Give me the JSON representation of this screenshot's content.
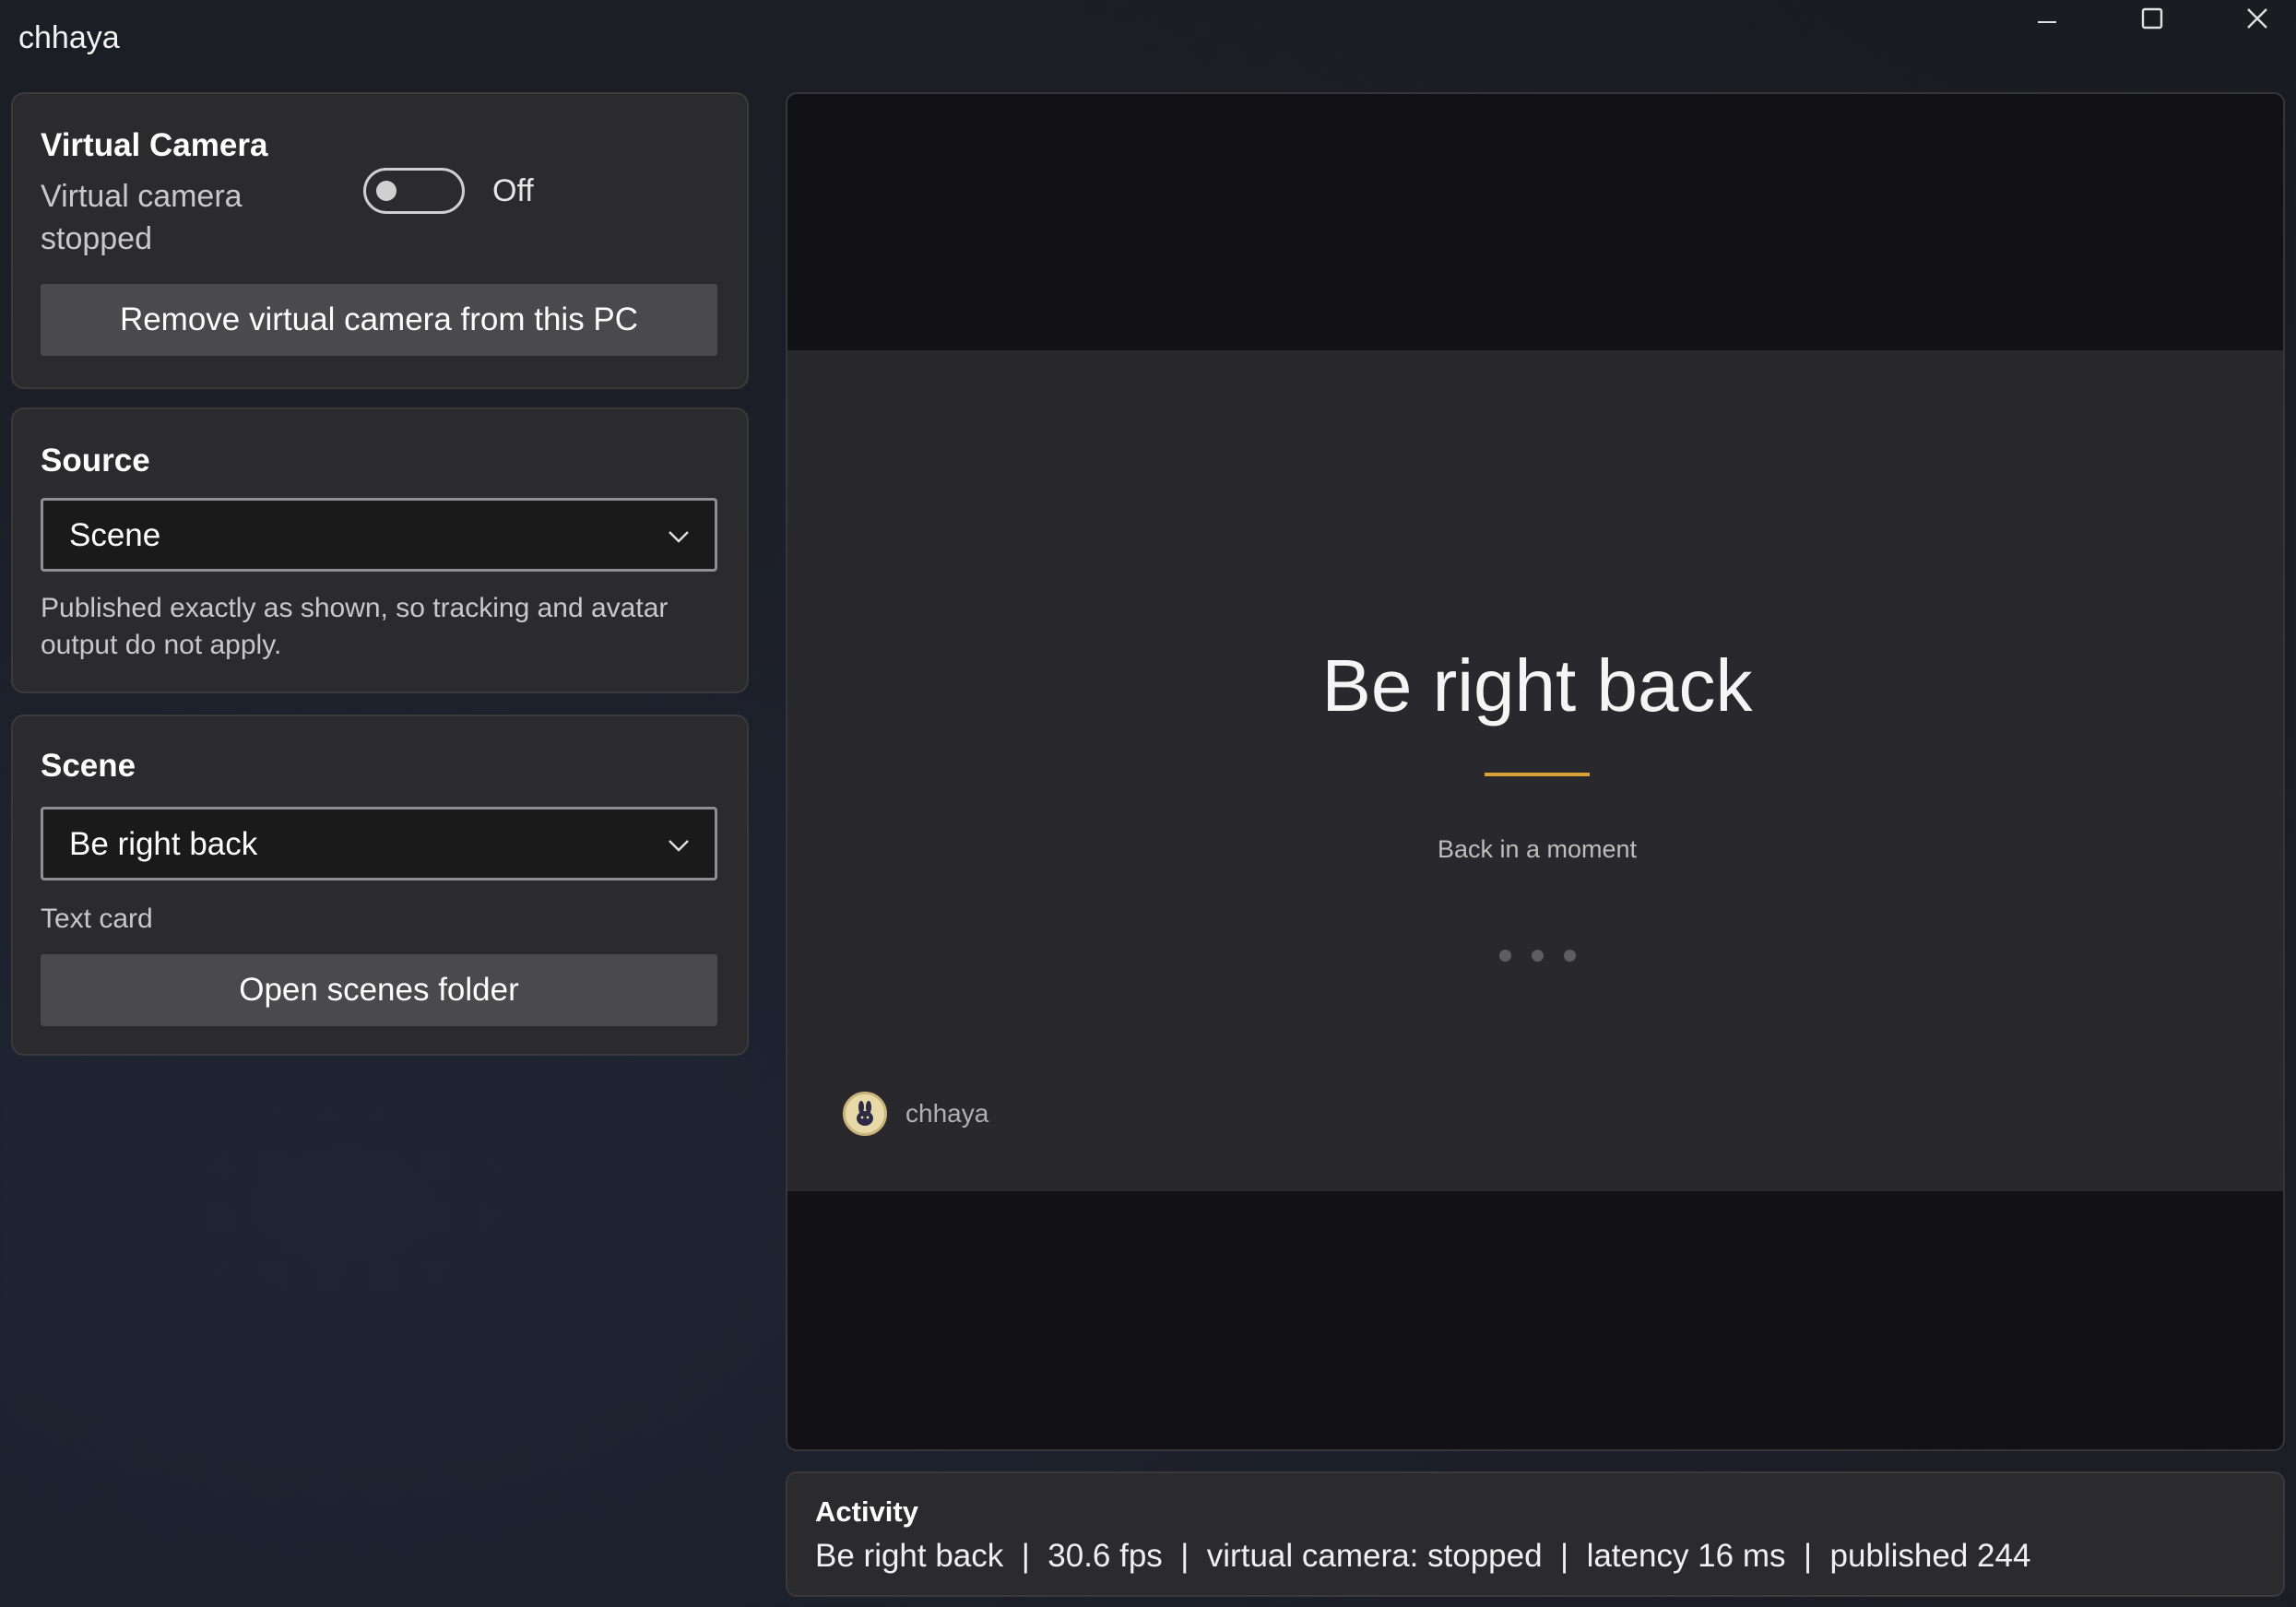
{
  "window": {
    "title": "chhaya"
  },
  "virtual_camera": {
    "title": "Virtual Camera",
    "status": "Virtual camera stopped",
    "toggle_label": "Off",
    "toggle_on": false,
    "remove_button": "Remove virtual camera from this PC"
  },
  "source": {
    "title": "Source",
    "selected": "Scene",
    "help": "Published exactly as shown, so tracking and avatar output do not apply."
  },
  "scene": {
    "title": "Scene",
    "selected": "Be right back",
    "type": "Text card",
    "open_folder_button": "Open scenes folder"
  },
  "preview": {
    "title": "Be right back",
    "subtitle": "Back in a moment",
    "badge_name": "chhaya",
    "accent": "#d9a13a"
  },
  "activity": {
    "title": "Activity",
    "line": "Be right back  |  30.6 fps  |  virtual camera: stopped  |  latency 16 ms  |  published 244"
  }
}
